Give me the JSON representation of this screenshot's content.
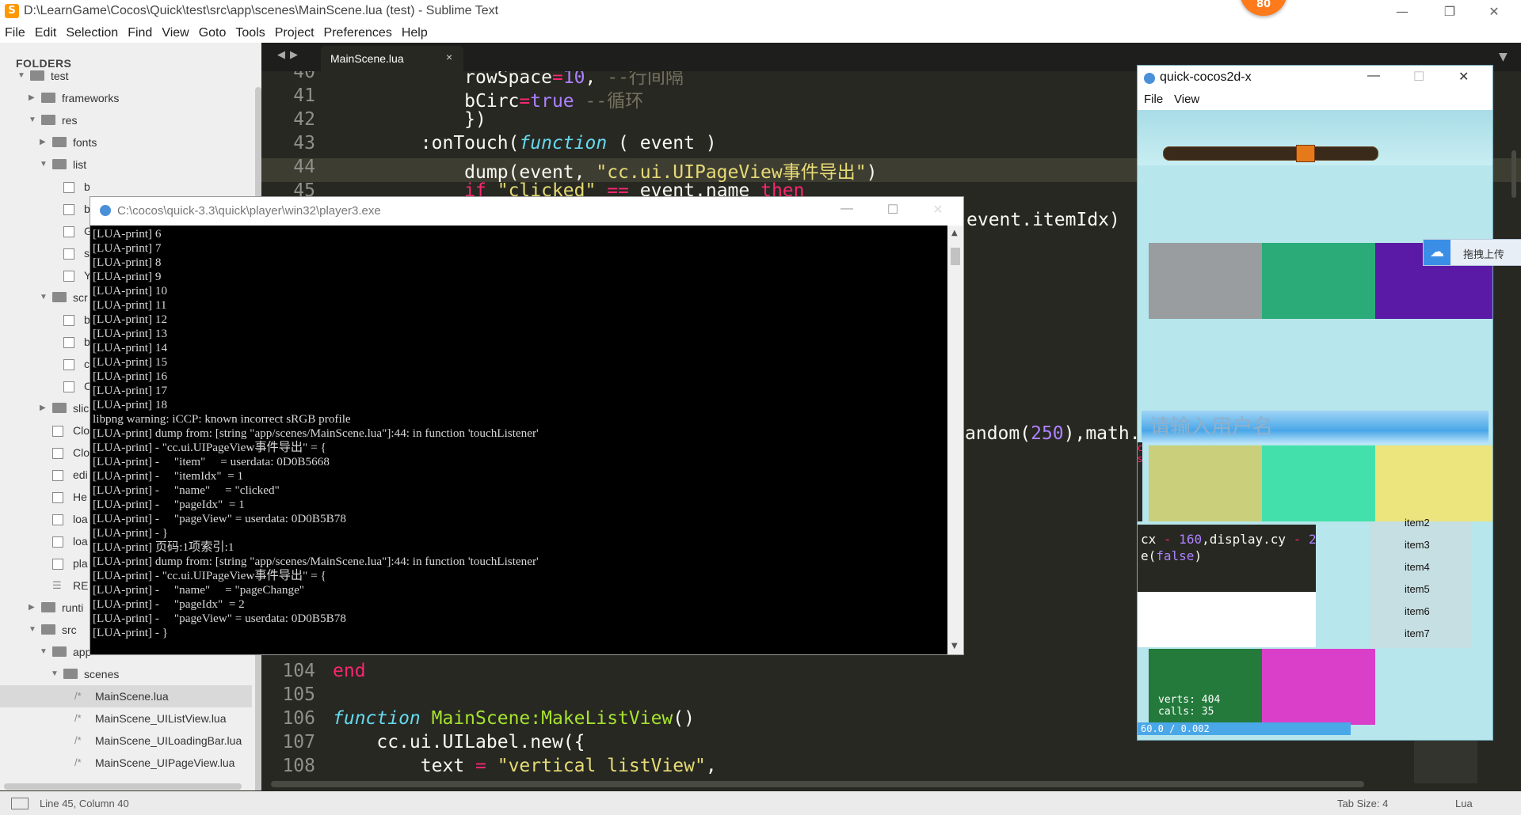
{
  "window": {
    "title": "D:\\LearnGame\\Cocos\\Quick\\test\\src\\app\\scenes\\MainScene.lua (test) - Sublime Text",
    "badge": "80",
    "controls": [
      "—",
      "❐",
      "✕"
    ]
  },
  "menu": [
    "File",
    "Edit",
    "Selection",
    "Find",
    "View",
    "Goto",
    "Tools",
    "Project",
    "Preferences",
    "Help"
  ],
  "sidebar": {
    "header": "FOLDERS",
    "rows": [
      {
        "indent": 0,
        "arrow": "▼",
        "type": "folder",
        "label": "test"
      },
      {
        "indent": 1,
        "arrow": "▶",
        "type": "folder",
        "label": "frameworks"
      },
      {
        "indent": 1,
        "arrow": "▼",
        "type": "folder",
        "label": "res"
      },
      {
        "indent": 2,
        "arrow": "▶",
        "type": "folder",
        "label": "fonts"
      },
      {
        "indent": 2,
        "arrow": "▼",
        "type": "folder",
        "label": "list"
      },
      {
        "indent": 3,
        "arrow": "",
        "type": "file",
        "label": "b"
      },
      {
        "indent": 3,
        "arrow": "",
        "type": "file",
        "label": "b"
      },
      {
        "indent": 3,
        "arrow": "",
        "type": "file",
        "label": "G"
      },
      {
        "indent": 3,
        "arrow": "",
        "type": "file",
        "label": "s"
      },
      {
        "indent": 3,
        "arrow": "",
        "type": "file",
        "label": "Y"
      },
      {
        "indent": 2,
        "arrow": "▼",
        "type": "folder",
        "label": "scr"
      },
      {
        "indent": 3,
        "arrow": "",
        "type": "file",
        "label": "b"
      },
      {
        "indent": 3,
        "arrow": "",
        "type": "file",
        "label": "b"
      },
      {
        "indent": 3,
        "arrow": "",
        "type": "file",
        "label": "c"
      },
      {
        "indent": 3,
        "arrow": "",
        "type": "file",
        "label": "C"
      },
      {
        "indent": 2,
        "arrow": "▶",
        "type": "folder",
        "label": "slic"
      },
      {
        "indent": 2,
        "arrow": "",
        "type": "file",
        "label": "Clo"
      },
      {
        "indent": 2,
        "arrow": "",
        "type": "file",
        "label": "Clo"
      },
      {
        "indent": 2,
        "arrow": "",
        "type": "file",
        "label": "edi"
      },
      {
        "indent": 2,
        "arrow": "",
        "type": "file",
        "label": "He"
      },
      {
        "indent": 2,
        "arrow": "",
        "type": "file",
        "label": "loa"
      },
      {
        "indent": 2,
        "arrow": "",
        "type": "file",
        "label": "loa"
      },
      {
        "indent": 2,
        "arrow": "",
        "type": "file",
        "label": "pla"
      },
      {
        "indent": 2,
        "arrow": "",
        "type": "text",
        "label": "RE"
      },
      {
        "indent": 1,
        "arrow": "▶",
        "type": "folder",
        "label": "runti"
      },
      {
        "indent": 1,
        "arrow": "▼",
        "type": "folder",
        "label": "src"
      },
      {
        "indent": 2,
        "arrow": "▼",
        "type": "folder",
        "label": "app"
      },
      {
        "indent": 3,
        "arrow": "▼",
        "type": "folder",
        "label": "scenes"
      },
      {
        "indent": 4,
        "arrow": "",
        "type": "lua",
        "label": "MainScene.lua",
        "selected": true
      },
      {
        "indent": 4,
        "arrow": "",
        "type": "lua",
        "label": "MainScene_UIListView.lua"
      },
      {
        "indent": 4,
        "arrow": "",
        "type": "lua",
        "label": "MainScene_UILoadingBar.lua"
      },
      {
        "indent": 4,
        "arrow": "",
        "type": "lua",
        "label": "MainScene_UIPageView.lua"
      }
    ]
  },
  "tab": {
    "label": "MainScene.lua",
    "close": "×"
  },
  "editor": {
    "lines_top": [
      {
        "n": "40",
        "parts": [
          [
            "",
            "            rowSpace"
          ],
          [
            "op",
            "="
          ],
          [
            "num",
            "10"
          ],
          [
            "",
            ", "
          ],
          [
            "cm",
            "--行间隔"
          ]
        ]
      },
      {
        "n": "41",
        "parts": [
          [
            "",
            "            bCirc"
          ],
          [
            "op",
            "="
          ],
          [
            "num",
            "true"
          ],
          [
            "",
            ""
          ],
          [
            "cm",
            " --循环"
          ]
        ]
      },
      {
        "n": "42",
        "parts": [
          [
            "",
            "            })"
          ]
        ]
      },
      {
        "n": "43",
        "parts": [
          [
            "",
            "        :onTouch("
          ],
          [
            "fn",
            "function"
          ],
          [
            "",
            " ( event )"
          ]
        ]
      },
      {
        "n": "44",
        "parts": [
          [
            "",
            "            dump(event, "
          ],
          [
            "str",
            "\"cc.ui.UIPageView事件导出\""
          ],
          [
            "",
            ")"
          ]
        ]
      },
      {
        "n": "45",
        "parts": [
          [
            "",
            "            "
          ],
          [
            "kw",
            "if"
          ],
          [
            "str",
            " \"clicked\""
          ],
          [
            "",
            " "
          ],
          [
            "op",
            "=="
          ],
          [
            "",
            " event.name "
          ],
          [
            "kw",
            "then"
          ]
        ]
      }
    ],
    "frag_itemidx": "event.itemIdx)",
    "frag_random": [
      "andom(",
      "250",
      "),math."
    ],
    "lines_bottom": [
      {
        "n": "104",
        "parts": [
          [
            "kw",
            "end"
          ]
        ]
      },
      {
        "n": "105",
        "parts": [
          [
            "",
            ""
          ]
        ]
      },
      {
        "n": "106",
        "parts": [
          [
            "fn",
            "function"
          ],
          [
            "",
            " "
          ],
          [
            "nm",
            "MainScene:MakeListView"
          ],
          [
            "",
            "()"
          ]
        ]
      },
      {
        "n": "107",
        "parts": [
          [
            "",
            "    cc.ui.UILabel.new({"
          ]
        ]
      },
      {
        "n": "108",
        "parts": [
          [
            "",
            "        text "
          ],
          [
            "op",
            "="
          ],
          [
            "",
            " "
          ],
          [
            "str",
            "\"vertical listView\""
          ],
          [
            "",
            ","
          ]
        ]
      }
    ]
  },
  "console": {
    "title": "C:\\cocos\\quick-3.3\\quick\\player\\win32\\player3.exe",
    "lines": [
      "[LUA-print] 6",
      "[LUA-print] 7",
      "[LUA-print] 8",
      "[LUA-print] 9",
      "[LUA-print] 10",
      "[LUA-print] 11",
      "[LUA-print] 12",
      "[LUA-print] 13",
      "[LUA-print] 14",
      "[LUA-print] 15",
      "[LUA-print] 16",
      "[LUA-print] 17",
      "[LUA-print] 18",
      "libpng warning: iCCP: known incorrect sRGB profile",
      "[LUA-print] dump from: [string \"app/scenes/MainScene.lua\"]:44: in function 'touchListener'",
      "[LUA-print] - \"cc.ui.UIPageView事件导出\" = {",
      "[LUA-print] -     \"item\"     = userdata: 0D0B5668",
      "[LUA-print] -     \"itemIdx\"  = 1",
      "[LUA-print] -     \"name\"     = \"clicked\"",
      "[LUA-print] -     \"pageIdx\"  = 1",
      "[LUA-print] -     \"pageView\" = userdata: 0D0B5B78",
      "[LUA-print] - }",
      "[LUA-print] 页码:1项索引:1",
      "[LUA-print] dump from: [string \"app/scenes/MainScene.lua\"]:44: in function 'touchListener'",
      "[LUA-print] - \"cc.ui.UIPageView事件导出\" = {",
      "[LUA-print] -     \"name\"     = \"pageChange\"",
      "[LUA-print] -     \"pageIdx\"  = 2",
      "[LUA-print] -     \"pageView\" = userdata: 0D0B5B78",
      "[LUA-print] - }"
    ]
  },
  "qc": {
    "title": "quick-cocos2d-x",
    "menu": [
      "File",
      "View"
    ],
    "placeholder": "请输入用户名",
    "items": [
      "item2",
      "item3",
      "item4",
      "item5",
      "item6",
      "item7"
    ],
    "code_frag1": [
      "cx ",
      "-",
      " 160",
      ",display.cy ",
      "-",
      " 2"
    ],
    "code_frag2": [
      "e(",
      "false",
      ")"
    ],
    "stats": [
      "verts:   404",
      "calls:    35",
      "60.0 / 0.002"
    ],
    "side_chars": [
      "c",
      "s"
    ]
  },
  "upload_label": "拖拽上传",
  "status": {
    "position": "Line 45, Column 40",
    "tab_size": "Tab Size: 4",
    "syntax": "Lua"
  }
}
